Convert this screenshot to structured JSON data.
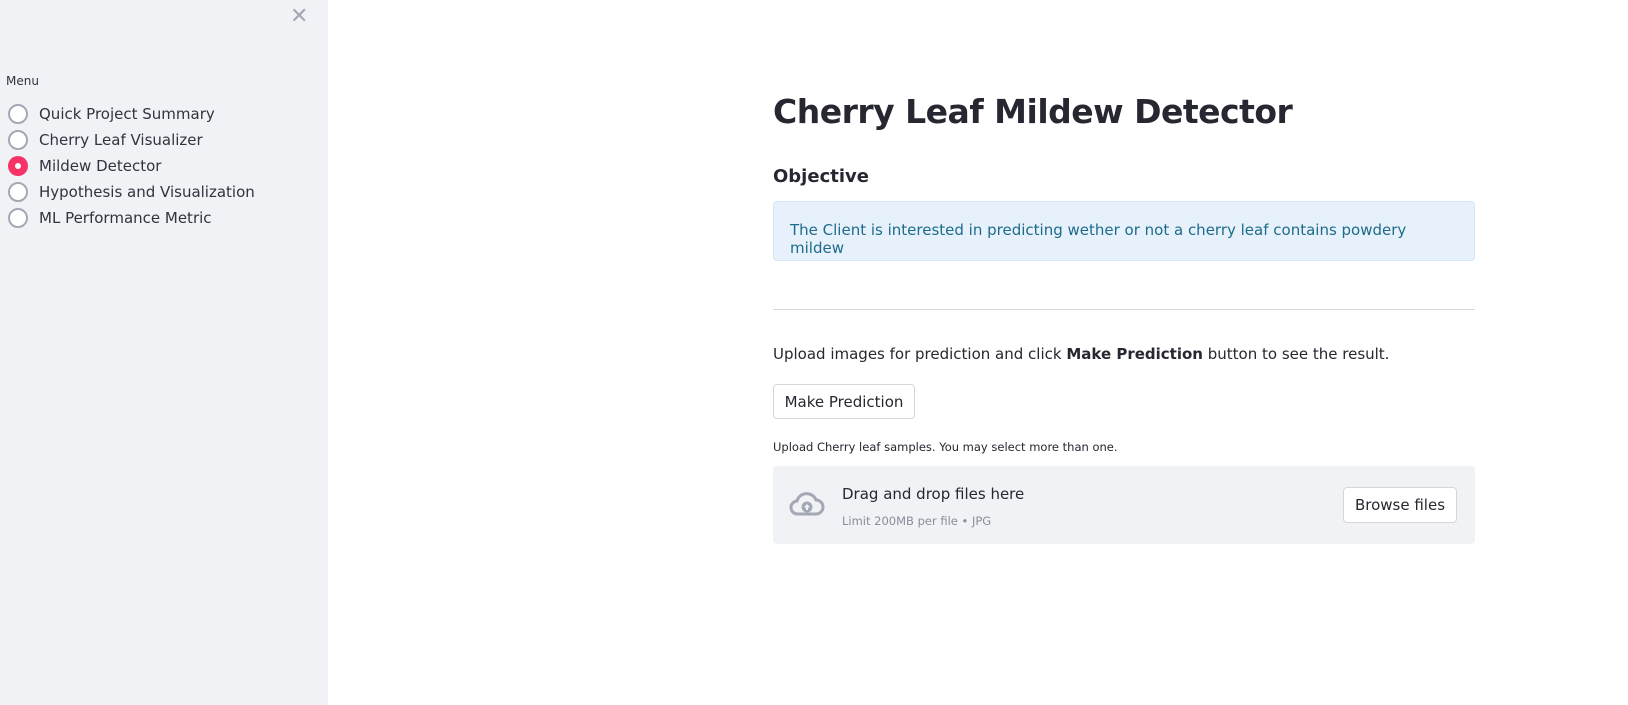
{
  "sidebar": {
    "menu_label": "Menu",
    "items": [
      {
        "label": "Quick Project Summary",
        "selected": false
      },
      {
        "label": "Cherry Leaf Visualizer",
        "selected": false
      },
      {
        "label": "Mildew Detector",
        "selected": true
      },
      {
        "label": "Hypothesis and Visualization",
        "selected": false
      },
      {
        "label": "ML Performance Metric",
        "selected": false
      }
    ],
    "accent": "#f63366"
  },
  "main": {
    "title": "Cherry Leaf Mildew Detector",
    "subtitle": "Objective",
    "info": "The Client is interested in predicting wether or not a cherry leaf contains powdery mildew",
    "instruction_pre": "Upload images for prediction and click ",
    "instruction_bold": "Make Prediction",
    "instruction_post": " button to see the result.",
    "predict_button": "Make Prediction",
    "uploader": {
      "label": "Upload Cherry leaf samples. You may select more than one.",
      "drop_text": "Drag and drop files here",
      "limit_text": "Limit 200MB per file • JPG",
      "browse_button": "Browse files"
    }
  }
}
